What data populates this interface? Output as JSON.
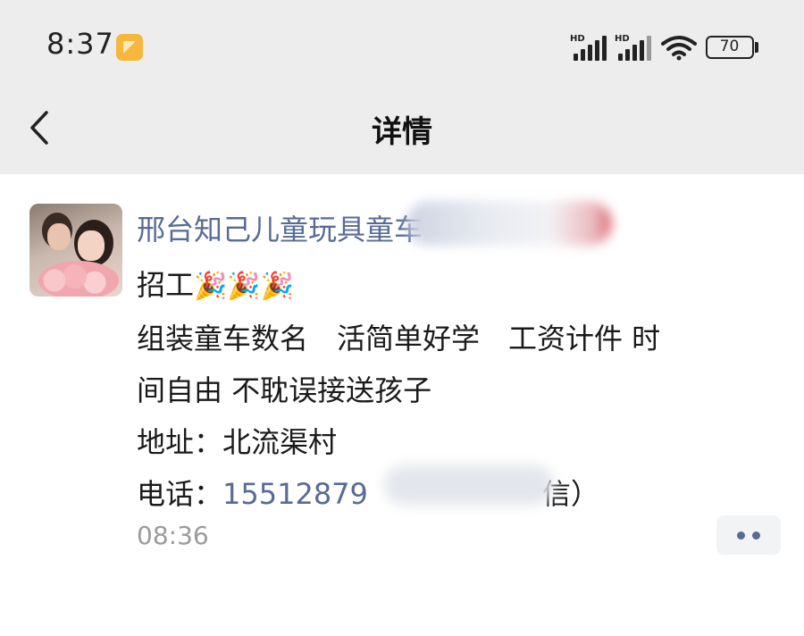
{
  "status_bar": {
    "time": "8:37",
    "signal_1_label": "HD",
    "signal_2_label": "HD",
    "battery_level": "70",
    "icons": [
      "notification-app-icon",
      "signal-icon",
      "signal-icon",
      "wifi-icon",
      "battery-icon"
    ]
  },
  "nav": {
    "back_icon": "chevron-left-icon",
    "title": "详情"
  },
  "post": {
    "author": "邢台知己儿童玩具童车",
    "content": {
      "line1": "招工",
      "line1_emojis": "🎉🎉🎉",
      "line2": "组装童车数名　活简单好学　工资计件  时",
      "line3": "间自由  不耽误接送孩子",
      "line4": "地址：北流渠村",
      "line5_label": "电话：",
      "line5_phone": "15512879",
      "line5_suffix": "信）"
    },
    "timestamp": "08:36",
    "more_icon": "more-dots-icon"
  },
  "colors": {
    "link": "#576b95",
    "header_bg": "#ededed",
    "timestamp": "#9b9b9b"
  }
}
